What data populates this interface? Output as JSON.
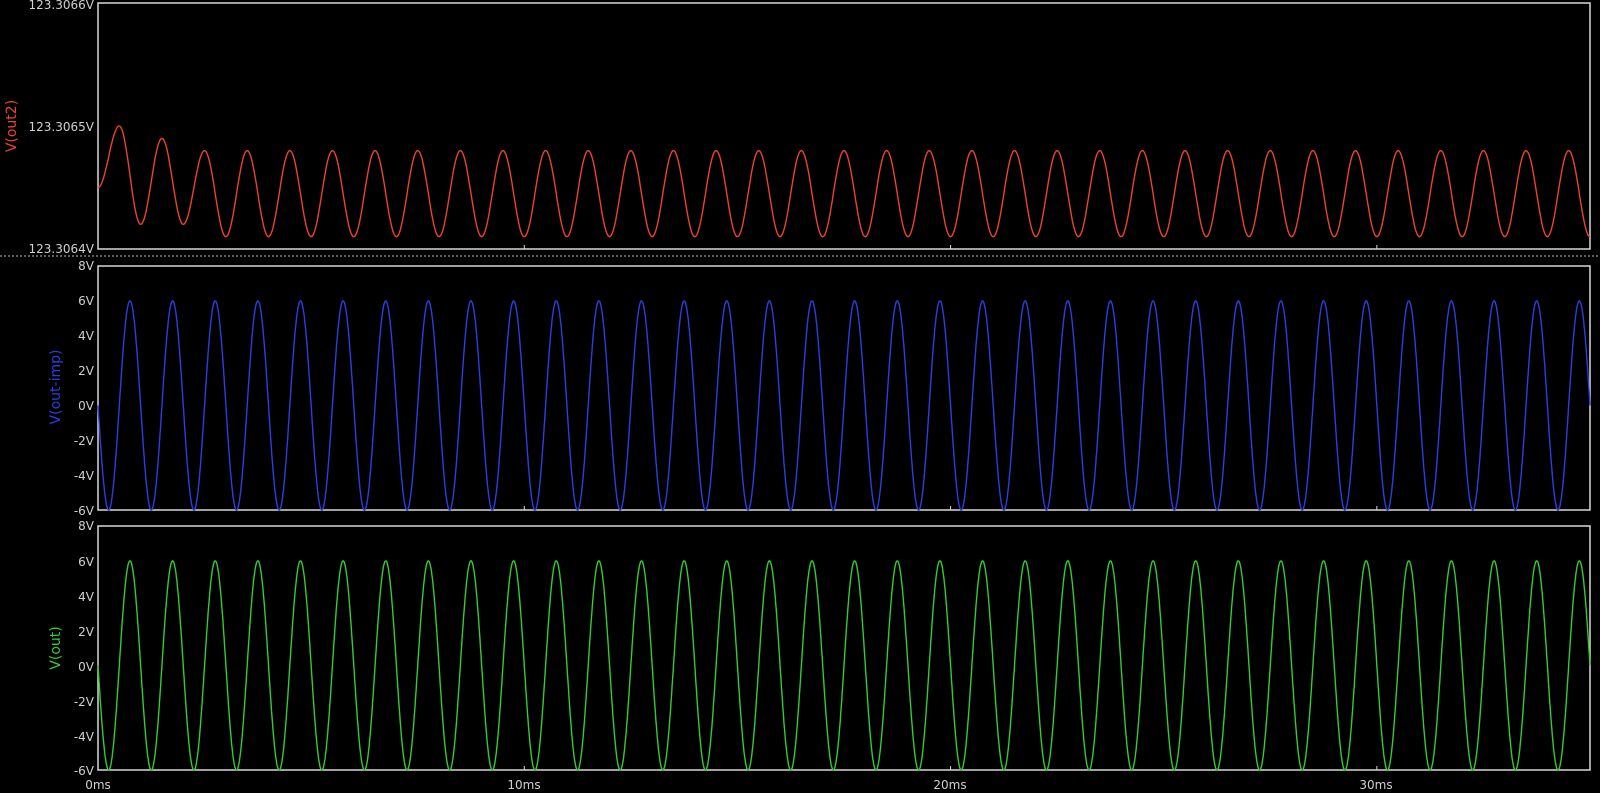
{
  "chart_data": [
    {
      "type": "line",
      "ylabel": "V(out2)",
      "color": "#e8452a",
      "yticks": [
        "123.3066V",
        "123.3065V",
        "123.3064V"
      ],
      "ylim": [
        123.3064,
        123.3066
      ],
      "xlim": [
        0,
        35
      ],
      "series": [
        {
          "name": "V(out2)",
          "x_unit": "ms",
          "x": [
            0.0,
            0.5,
            1.0,
            1.5,
            2.0,
            2.5,
            3.0,
            3.5,
            4.0,
            4.5,
            5.0,
            5.5,
            6.0,
            6.5,
            7.0,
            7.5,
            8.0,
            8.5,
            9.0,
            9.5,
            10.0,
            10.5,
            11.0,
            11.5,
            12.0,
            12.5,
            13.0,
            13.5,
            14.0,
            14.5,
            15.0,
            15.5,
            16.0,
            16.5,
            17.0,
            17.5,
            18.0,
            18.5,
            19.0,
            19.5,
            20.0,
            20.5,
            21.0,
            21.5,
            22.0,
            22.5,
            23.0,
            23.5,
            24.0,
            24.5,
            25.0,
            25.5,
            26.0,
            26.5,
            27.0,
            27.5,
            28.0,
            28.5,
            29.0,
            29.5,
            30.0,
            30.5,
            31.0,
            31.5,
            32.0,
            32.5,
            33.0,
            33.5,
            34.0,
            34.5,
            35.0
          ],
          "y": [
            123.30645,
            123.3065,
            123.30642,
            123.30649,
            123.30642,
            123.30648,
            123.30641,
            123.30648,
            123.30641,
            123.30648,
            123.30641,
            123.30648,
            123.30641,
            123.30648,
            123.30641,
            123.30648,
            123.30641,
            123.30648,
            123.30641,
            123.30648,
            123.30641,
            123.30648,
            123.30641,
            123.30648,
            123.30641,
            123.30648,
            123.30641,
            123.30648,
            123.30641,
            123.30648,
            123.30641,
            123.30648,
            123.30641,
            123.30648,
            123.30641,
            123.30648,
            123.30641,
            123.30648,
            123.30641,
            123.30648,
            123.30641,
            123.30648,
            123.30641,
            123.30648,
            123.30641,
            123.30648,
            123.30641,
            123.30648,
            123.30641,
            123.30648,
            123.30641,
            123.30648,
            123.30641,
            123.30648,
            123.30641,
            123.30648,
            123.30641,
            123.30648,
            123.30641,
            123.30648,
            123.30641,
            123.30648,
            123.30641,
            123.30648,
            123.30641,
            123.30648,
            123.30641,
            123.30648,
            123.30641,
            123.30648,
            123.30641
          ]
        }
      ]
    },
    {
      "type": "line",
      "ylabel": "V(out-imp)",
      "color": "#2a3fe0",
      "yticks": [
        "8V",
        "6V",
        "4V",
        "2V",
        "0V",
        "-2V",
        "-4V",
        "-6V"
      ],
      "ylim": [
        -6,
        8
      ],
      "xlim": [
        0,
        35
      ],
      "series": [
        {
          "name": "V(out-imp)",
          "waveform": "sine",
          "amplitude": 6,
          "offset": 0,
          "frequency_hz": 1000,
          "x_range_ms": [
            0,
            35
          ]
        }
      ]
    },
    {
      "type": "line",
      "ylabel": "V(out)",
      "color": "#33cc33",
      "yticks": [
        "8V",
        "6V",
        "4V",
        "2V",
        "0V",
        "-2V",
        "-4V",
        "-6V"
      ],
      "ylim": [
        -6,
        8
      ],
      "xlim": [
        0,
        35
      ],
      "series": [
        {
          "name": "V(out)",
          "waveform": "sine",
          "amplitude": 6,
          "offset": 0,
          "frequency_hz": 1000,
          "x_range_ms": [
            0,
            35
          ]
        }
      ]
    }
  ],
  "x_axis": {
    "ticks": [
      "0ms",
      "10ms",
      "20ms",
      "30ms"
    ],
    "tick_values_ms": [
      0,
      10,
      20,
      30
    ],
    "xlim_ms": [
      0,
      35
    ]
  },
  "colors": {
    "background": "#000000",
    "frame": "#d8d8d8",
    "tick_text": "#d0d0d0"
  }
}
